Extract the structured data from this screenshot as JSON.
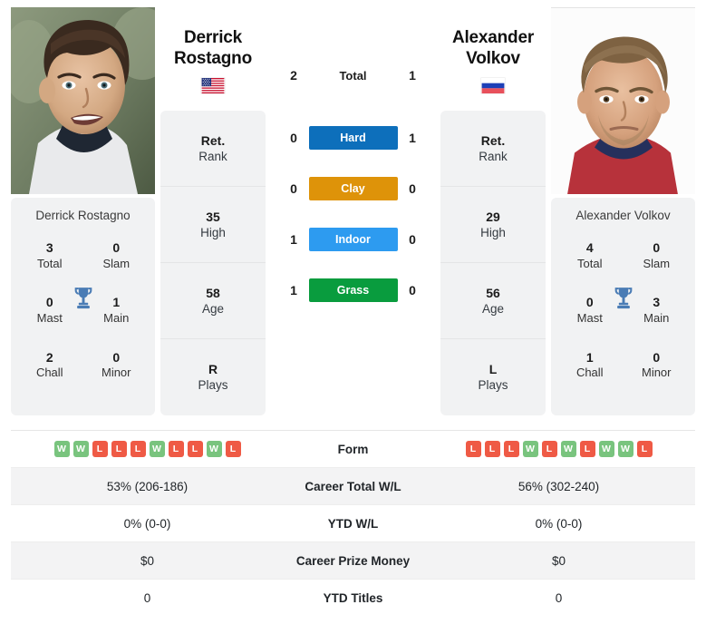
{
  "players": {
    "left": {
      "first_name": "Derrick",
      "last_name": "Rostagno",
      "full_name": "Derrick Rostagno",
      "country": "USA",
      "flag_icon": "us-flag-icon",
      "photo_alt": "Derrick Rostagno photo",
      "info": [
        {
          "value": "Ret.",
          "label": "Rank"
        },
        {
          "value": "35",
          "label": "High"
        },
        {
          "value": "58",
          "label": "Age"
        },
        {
          "value": "R",
          "label": "Plays"
        }
      ],
      "titles": [
        {
          "value": "3",
          "label": "Total"
        },
        {
          "value": "0",
          "label": "Slam"
        },
        {
          "value": "0",
          "label": "Mast"
        },
        {
          "value": "1",
          "label": "Main"
        },
        {
          "value": "2",
          "label": "Chall"
        },
        {
          "value": "0",
          "label": "Minor"
        }
      ],
      "form": [
        "W",
        "W",
        "L",
        "L",
        "L",
        "W",
        "L",
        "L",
        "W",
        "L"
      ],
      "career_total_wl": "53% (206-186)",
      "ytd_wl": "0% (0-0)",
      "career_prize_money": "$0",
      "ytd_titles": "0"
    },
    "right": {
      "first_name": "Alexander",
      "last_name": "Volkov",
      "full_name": "Alexander Volkov",
      "country": "RUS",
      "flag_icon": "ru-flag-icon",
      "photo_alt": "Alexander Volkov photo",
      "info": [
        {
          "value": "Ret.",
          "label": "Rank"
        },
        {
          "value": "29",
          "label": "High"
        },
        {
          "value": "56",
          "label": "Age"
        },
        {
          "value": "L",
          "label": "Plays"
        }
      ],
      "titles": [
        {
          "value": "4",
          "label": "Total"
        },
        {
          "value": "0",
          "label": "Slam"
        },
        {
          "value": "0",
          "label": "Mast"
        },
        {
          "value": "3",
          "label": "Main"
        },
        {
          "value": "1",
          "label": "Chall"
        },
        {
          "value": "0",
          "label": "Minor"
        }
      ],
      "form": [
        "L",
        "L",
        "L",
        "W",
        "L",
        "W",
        "L",
        "W",
        "W",
        "L"
      ],
      "career_total_wl": "56% (302-240)",
      "ytd_wl": "0% (0-0)",
      "career_prize_money": "$0",
      "ytd_titles": "0"
    }
  },
  "surfaces": [
    {
      "name": "Total",
      "left": "2",
      "right": "1",
      "color": "",
      "style": "plain"
    },
    {
      "name": "Hard",
      "left": "0",
      "right": "1",
      "color": "#0d6fbb",
      "style": "bar"
    },
    {
      "name": "Clay",
      "left": "0",
      "right": "0",
      "color": "#de9309",
      "style": "bar"
    },
    {
      "name": "Indoor",
      "left": "1",
      "right": "0",
      "color": "#2d9bf0",
      "style": "bar"
    },
    {
      "name": "Grass",
      "left": "1",
      "right": "0",
      "color": "#099c3e",
      "style": "bar"
    }
  ],
  "stats_rows": [
    {
      "label": "Form",
      "left": "",
      "right": "",
      "type": "form"
    },
    {
      "label": "Career Total W/L",
      "left": "53% (206-186)",
      "right": "56% (302-240)",
      "type": "text"
    },
    {
      "label": "YTD W/L",
      "left": "0% (0-0)",
      "right": "0% (0-0)",
      "type": "text"
    },
    {
      "label": "Career Prize Money",
      "left": "$0",
      "right": "$0",
      "type": "text"
    },
    {
      "label": "YTD Titles",
      "left": "0",
      "right": "0",
      "type": "text"
    }
  ],
  "colors": {
    "hard": "#0d6fbb",
    "clay": "#de9309",
    "indoor": "#2d9bf0",
    "grass": "#099c3e",
    "win_badge": "#79c47e",
    "loss_badge": "#ef5a45",
    "trophy": "#4a7cb5",
    "panel_bg": "#f1f2f3"
  },
  "icons": {
    "trophy": "trophy-icon"
  }
}
